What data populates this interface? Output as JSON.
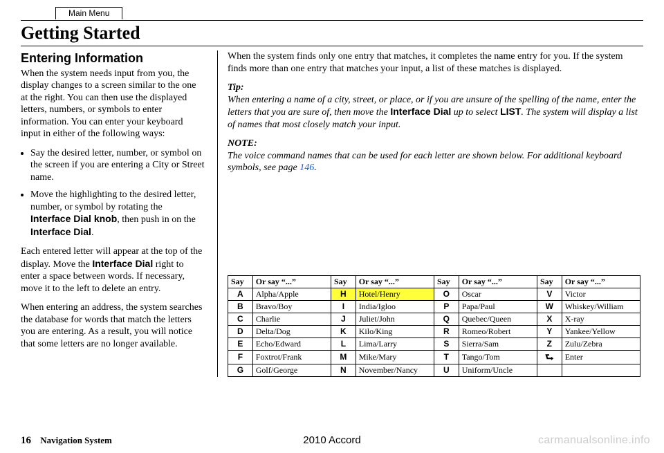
{
  "header": {
    "mainMenu": "Main Menu",
    "title": "Getting Started"
  },
  "left": {
    "sectionHeading": "Entering Information",
    "intro": "When the system needs input from you, the display changes to a screen similar to the one at the right. You can then use the displayed letters, numbers, or symbols to enter information. You can enter your keyboard input in either of the following ways:",
    "bullets": [
      "Say the desired letter, number, or symbol on the screen if you are entering a City or Street name.",
      {
        "pre": "Move the highlighting to the desired letter, number, or symbol by rotating the ",
        "b1": "Interface Dial knob",
        "mid": ", then push in on the ",
        "b2": "Interface Dial",
        "post": "."
      }
    ],
    "para3_pre": "Each entered letter will appear at the top of the display. Move the ",
    "para3_b": "Interface Dial",
    "para3_post": " right to enter a space between words. If necessary, move it to the left to delete an entry.",
    "para4": "When entering an address, the system searches the database for words that match the letters you are entering. As a result, you will notice that some letters are no longer available."
  },
  "right": {
    "para1": "When the system finds only one entry that matches, it completes the name entry for you. If the system finds more than one entry that matches your input, a list of these matches is displayed.",
    "tipLabel": "Tip:",
    "tip_pre": "When entering a name of a city, street, or place, or if you are unsure of the spelling of the name, enter the letters that you are sure of, then move the ",
    "tipB1": "Interface Dial",
    "tip_mid": " up to select ",
    "tipB2": "LIST",
    "tip_post": ". The system will display a list of names that most closely match your input.",
    "noteLabel": "NOTE:",
    "note_pre": "The voice command names that can be used for each letter are shown below. For additional keyboard symbols, see page ",
    "noteLink": "146",
    "note_post": "."
  },
  "table": {
    "headers": [
      "Say",
      "Or say “...”",
      "Say",
      "Or say “...”",
      "Say",
      "Or say “...”",
      "Say",
      "Or say “...”"
    ],
    "rows": [
      [
        "A",
        "Alpha/Apple",
        "H",
        "Hotel/Henry",
        "O",
        "Oscar",
        "V",
        "Victor"
      ],
      [
        "B",
        "Bravo/Boy",
        "I",
        "India/Igloo",
        "P",
        "Papa/Paul",
        "W",
        "Whiskey/William"
      ],
      [
        "C",
        "Charlie",
        "J",
        "Juliet/John",
        "Q",
        "Quebec/Queen",
        "X",
        "X-ray"
      ],
      [
        "D",
        "Delta/Dog",
        "K",
        "Kilo/King",
        "R",
        "Romeo/Robert",
        "Y",
        "Yankee/Yellow"
      ],
      [
        "E",
        "Echo/Edward",
        "L",
        "Lima/Larry",
        "S",
        "Sierra/Sam",
        "Z",
        "Zulu/Zebra"
      ],
      [
        "F",
        "Foxtrot/Frank",
        "M",
        "Mike/Mary",
        "T",
        "Tango/Tom",
        "↵",
        "Enter"
      ],
      [
        "G",
        "Golf/George",
        "N",
        "November/Nancy",
        "U",
        "Uniform/Uncle",
        "",
        ""
      ]
    ],
    "highlightCells": [
      [
        0,
        2
      ],
      [
        0,
        3
      ]
    ]
  },
  "footer": {
    "pageNum": "16",
    "systemLabel": "Navigation System",
    "model": "2010 Accord",
    "watermark": "carmanualsonline.info"
  }
}
